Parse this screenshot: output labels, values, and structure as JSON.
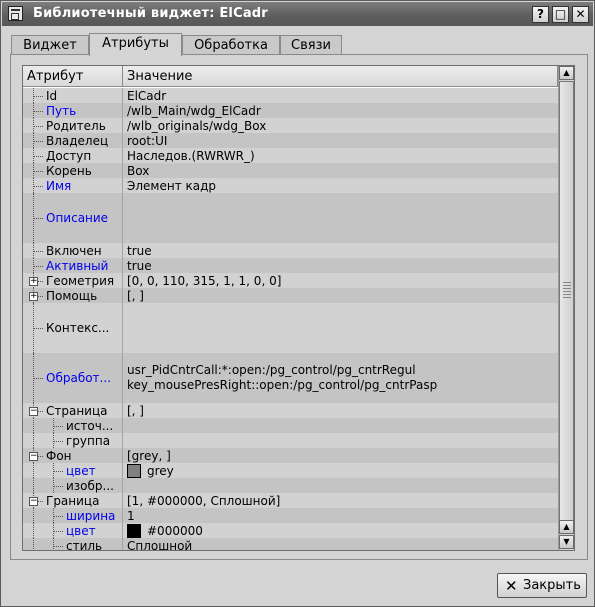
{
  "window": {
    "title": "Библиотечный виджет: ElCadr",
    "buttons": [
      "?",
      "□",
      "✕"
    ]
  },
  "tabs": [
    "Виджет",
    "Атрибуты",
    "Обработка",
    "Связи"
  ],
  "active_tab": "Атрибуты",
  "table": {
    "headers": [
      "Атрибут",
      "Значение"
    ],
    "rows": [
      {
        "name": "Id",
        "value": "ElCadr",
        "level": 0,
        "blue": false,
        "h": 15
      },
      {
        "name": "Путь",
        "value": "/wlb_Main/wdg_ElCadr",
        "level": 0,
        "blue": true,
        "h": 15
      },
      {
        "name": "Родитель",
        "value": "/wlb_originals/wdg_Box",
        "level": 0,
        "blue": false,
        "h": 15
      },
      {
        "name": "Владелец",
        "value": "root:UI",
        "level": 0,
        "blue": false,
        "h": 15
      },
      {
        "name": "Доступ",
        "value": "Наследов.(RWRWR_)",
        "level": 0,
        "blue": false,
        "h": 15
      },
      {
        "name": "Корень",
        "value": "Box",
        "level": 0,
        "blue": false,
        "h": 15
      },
      {
        "name": "Имя",
        "value": "Элемент кадр",
        "level": 0,
        "blue": true,
        "h": 15
      },
      {
        "name": "Описание",
        "value": "",
        "level": 0,
        "blue": true,
        "h": 50
      },
      {
        "name": "Включен",
        "value": "true",
        "level": 0,
        "blue": false,
        "h": 15
      },
      {
        "name": "Активный",
        "value": "true",
        "level": 0,
        "blue": true,
        "h": 15
      },
      {
        "name": "Геометрия",
        "value": "[0, 0, 110, 315, 1, 1, 0, 0]",
        "level": 0,
        "blue": false,
        "h": 15,
        "expander": "+"
      },
      {
        "name": "Помощь",
        "value": "[, ]",
        "level": 0,
        "blue": false,
        "h": 15,
        "expander": "+"
      },
      {
        "name": "Контекс...",
        "value": "",
        "level": 0,
        "blue": false,
        "h": 50
      },
      {
        "name": "Обработ...",
        "value": "usr_PidCntrCall:*:open:/pg_control/pg_cntrRegul\nkey_mousePresRight::open:/pg_control/pg_cntrPasp",
        "level": 0,
        "blue": true,
        "h": 50
      },
      {
        "name": "Страница",
        "value": "[, ]",
        "level": 0,
        "blue": false,
        "h": 15,
        "expander": "−"
      },
      {
        "name": "источ...",
        "value": "",
        "level": 1,
        "blue": false,
        "h": 15
      },
      {
        "name": "группа",
        "value": "",
        "level": 1,
        "blue": false,
        "h": 15
      },
      {
        "name": "Фон",
        "value": "[grey, ]",
        "level": 0,
        "blue": false,
        "h": 15,
        "expander": "−"
      },
      {
        "name": "цвет",
        "value": "grey",
        "level": 1,
        "blue": true,
        "h": 15,
        "swatch": "#808080"
      },
      {
        "name": "изобр...",
        "value": "",
        "level": 1,
        "blue": false,
        "h": 15
      },
      {
        "name": "Граница",
        "value": "[1, #000000, Сплошной]",
        "level": 0,
        "blue": false,
        "h": 15,
        "expander": "−"
      },
      {
        "name": "ширина",
        "value": "1",
        "level": 1,
        "blue": true,
        "h": 15
      },
      {
        "name": "цвет",
        "value": "#000000",
        "level": 1,
        "blue": true,
        "h": 15,
        "swatch": "#000000"
      },
      {
        "name": "стиль",
        "value": "Сплошной",
        "level": 1,
        "blue": false,
        "h": 15
      }
    ]
  },
  "footer": {
    "close_label": "Закрыть"
  },
  "colors": {
    "titlebar": "#666666",
    "link_blue": "#0000ee",
    "row_light": "#d2d2d2",
    "row_dark": "#c4c4c4"
  }
}
